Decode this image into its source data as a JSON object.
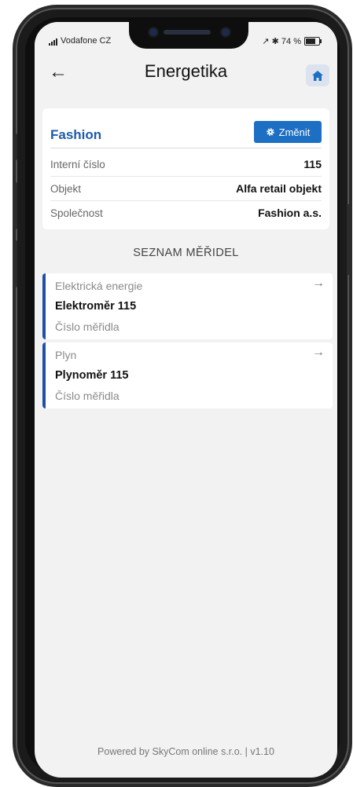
{
  "status_bar": {
    "carrier": "Vodafone CZ",
    "indicators": "↗ ✱ 74 %"
  },
  "header": {
    "back_icon": "arrow-left-icon",
    "title": "Energetika",
    "home_icon": "home-icon"
  },
  "info_card": {
    "name": "Fashion",
    "change_label": "Změnit",
    "change_icon": "gear-icon",
    "rows": [
      {
        "label": "Interní číslo",
        "value": "115"
      },
      {
        "label": "Objekt",
        "value": "Alfa retail objekt"
      },
      {
        "label": "Společnost",
        "value": "Fashion a.s."
      }
    ]
  },
  "section_title": "SEZNAM MĚŘIDEL",
  "meters": [
    {
      "type": "Elektrická energie",
      "name": "Elektroměr 115",
      "number_label": "Číslo měřidla",
      "arrow_icon": "arrow-right-icon"
    },
    {
      "type": "Plyn",
      "name": "Plynoměr 115",
      "number_label": "Číslo měřidla",
      "arrow_icon": "arrow-right-icon"
    }
  ],
  "footer": "Powered by SkyCom online s.r.o. | v1.10",
  "colors": {
    "accent": "#1d6fc4",
    "title_blue": "#1f5aa8",
    "meter_bar": "#1f4fa5",
    "background": "#f2f2f2"
  }
}
